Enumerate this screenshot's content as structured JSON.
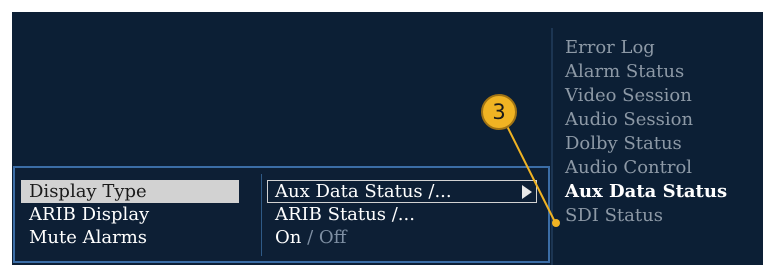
{
  "menu": {
    "rows": [
      {
        "label": "Display Type",
        "value": "Aux Data Status /..."
      },
      {
        "label": "ARIB Display",
        "value": "ARIB Status /..."
      },
      {
        "label": "Mute Alarms",
        "value_on": "On",
        "value_sep": " / ",
        "value_off": "Off"
      }
    ]
  },
  "submenu": {
    "items": [
      "Error Log",
      "Alarm Status",
      "Video Session",
      "Audio Session",
      "Dolby Status",
      "Audio Control",
      "Aux Data Status",
      "SDI Status"
    ],
    "active_index": 6
  },
  "callout": {
    "number": "3"
  },
  "colors": {
    "background": "#0c1f35",
    "panel_border": "#3b6da6",
    "selection": "#d2d2d2",
    "callout_fill": "#f0b323",
    "disabled_text": "#8d99a6"
  }
}
